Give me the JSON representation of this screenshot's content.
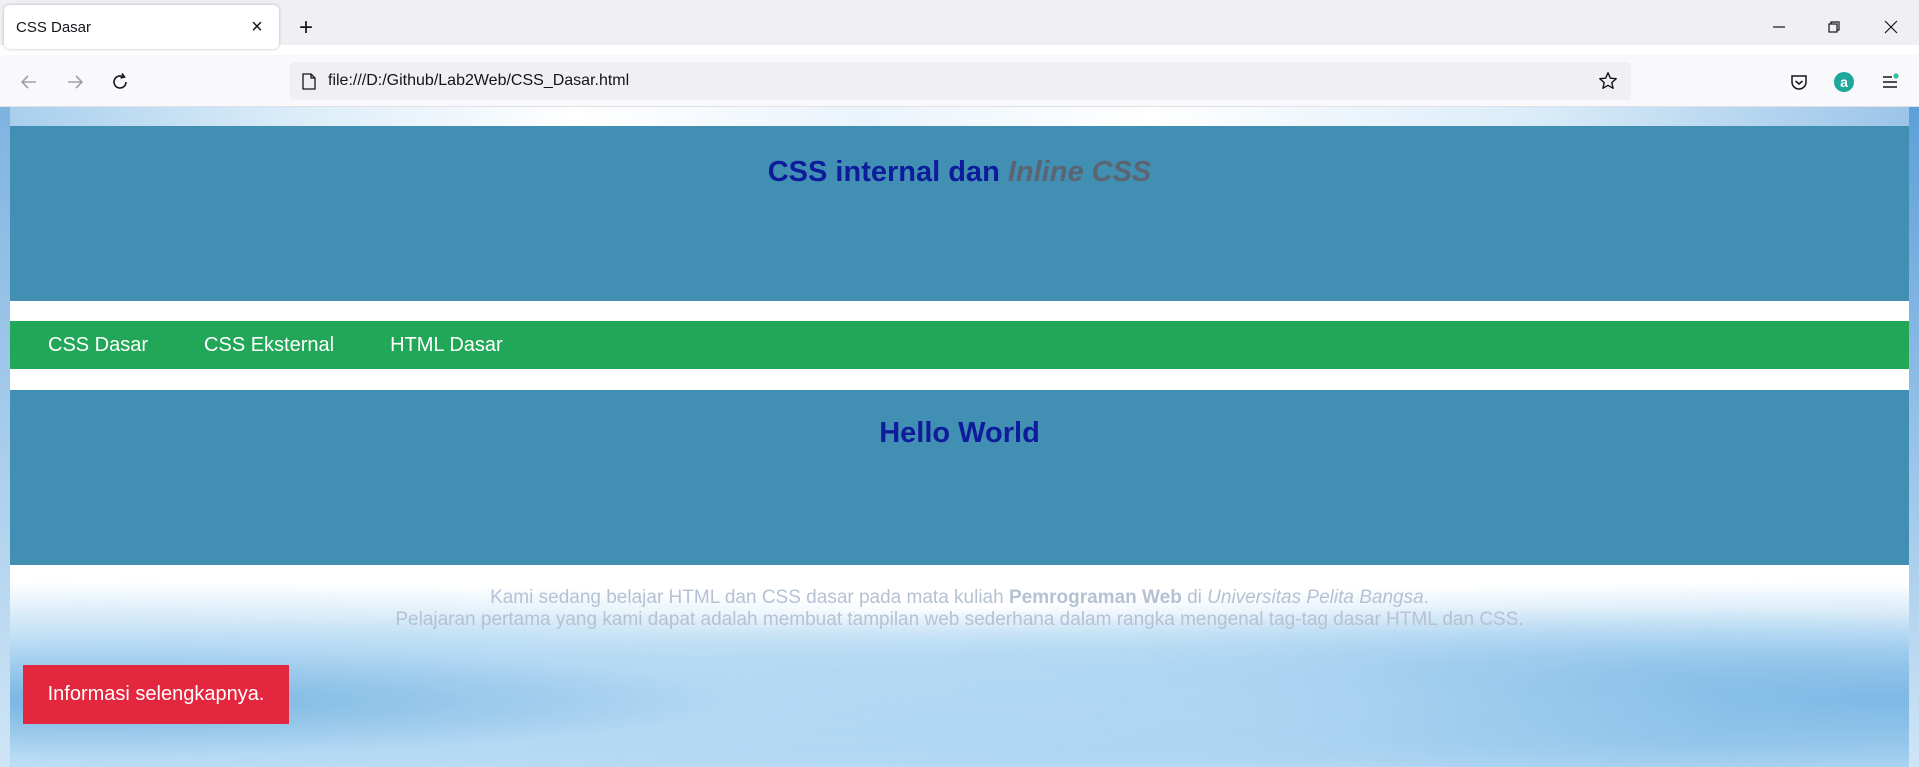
{
  "browser": {
    "tab_title": "CSS Dasar",
    "url": "file:///D:/Github/Lab2Web/CSS_Dasar.html",
    "accent": "#15141a"
  },
  "page": {
    "header": {
      "title_main": "CSS internal dan ",
      "title_inline": "Inline CSS",
      "bg": "#418fb3"
    },
    "menu": {
      "items": [
        {
          "label": "CSS Dasar"
        },
        {
          "label": "CSS Eksternal"
        },
        {
          "label": "HTML Dasar"
        }
      ],
      "bg": "#22a658"
    },
    "content": {
      "title": "Hello World"
    },
    "footer": {
      "line1_pre": "Kami sedang belajar HTML dan CSS dasar pada mata kuliah ",
      "line1_bold": "Pemrograman Web",
      "line1_mid": " di ",
      "line1_italic": "Universitas Pelita Bangsa",
      "line1_end": ".",
      "line2": "Pelajaran pertama yang kami dapat adalah membuat tampilan web sederhana dalam rangka mengenal tag-tag dasar HTML dan CSS."
    },
    "info_button": {
      "label": "Informasi selengkapnya.",
      "bg": "#e2273f"
    }
  }
}
